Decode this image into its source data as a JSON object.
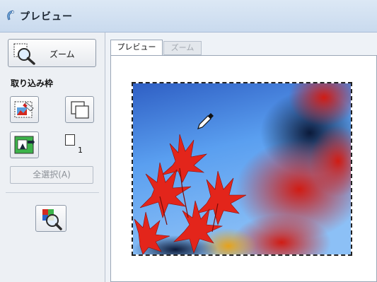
{
  "window": {
    "title": "プレビュー"
  },
  "toolbar": {
    "zoom_button_label": "ズーム"
  },
  "frame_section": {
    "label": "取り込み枠",
    "frame_count": "1"
  },
  "buttons": {
    "select_all_label": "全選択(A)"
  },
  "tabs": [
    {
      "label": "プレビュー",
      "active": true
    },
    {
      "label": "ズーム",
      "active": false
    }
  ],
  "colors": {
    "titlebar": "#cddcee",
    "panel_bg": "#edf0f4",
    "sky": "#4d8fe0",
    "leaves": "#e8241a"
  },
  "icons": [
    "scanner-app-icon",
    "zoom-magnifier-icon",
    "auto-locate-frame-icon",
    "duplicate-frame-icon",
    "frame-select-icon",
    "eyedropper-icon",
    "color-adjust-icon"
  ]
}
